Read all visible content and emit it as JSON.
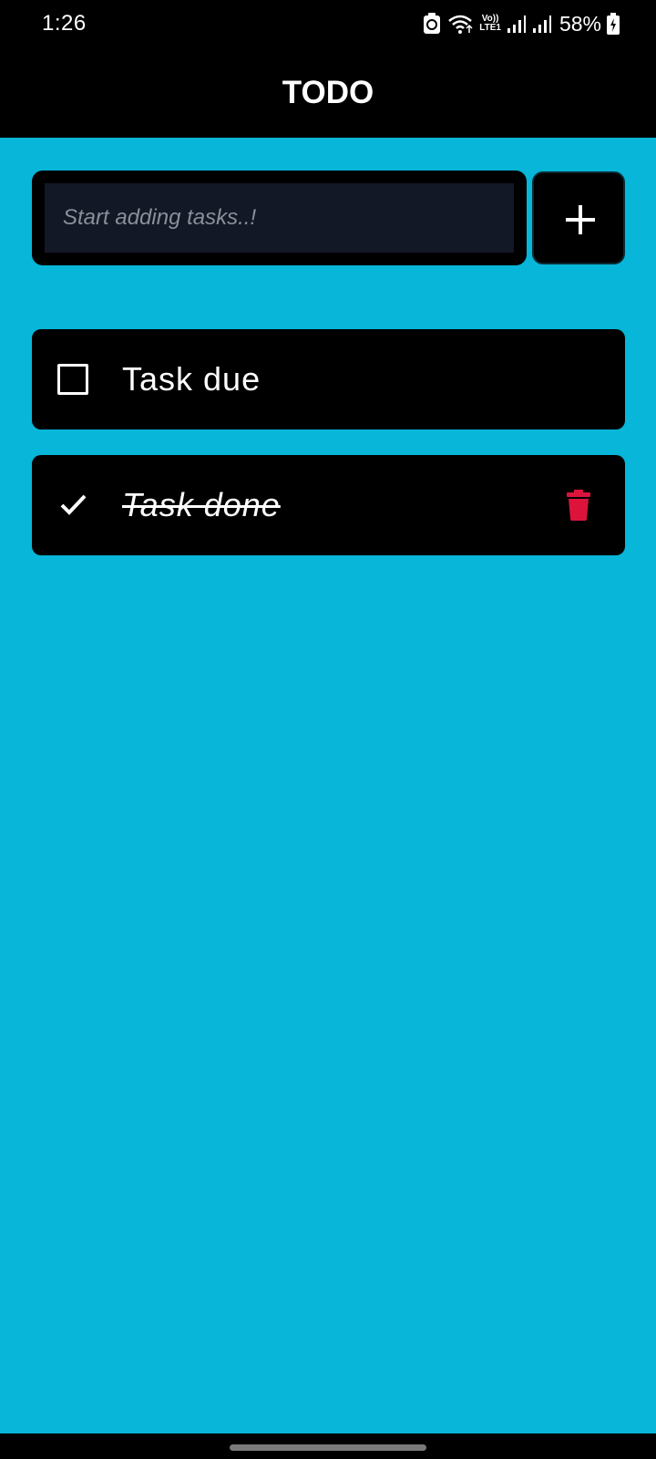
{
  "status": {
    "time": "1:26",
    "battery": "58%",
    "network_top": "Vo))",
    "network_bottom": "LTE1"
  },
  "app": {
    "title": "TODO"
  },
  "new_task": {
    "placeholder": "Start adding tasks..!",
    "value": "",
    "add_icon": "plus-icon"
  },
  "tasks": [
    {
      "label": "Task due",
      "done": false,
      "icon": "checkbox-empty"
    },
    {
      "label": "Task done",
      "done": true,
      "icon": "check-icon",
      "action_icon": "trash-icon"
    }
  ],
  "colors": {
    "background": "#07b6d8",
    "card": "#000000",
    "input": "#121826",
    "delete": "#dc143c",
    "text": "#ffffff"
  }
}
